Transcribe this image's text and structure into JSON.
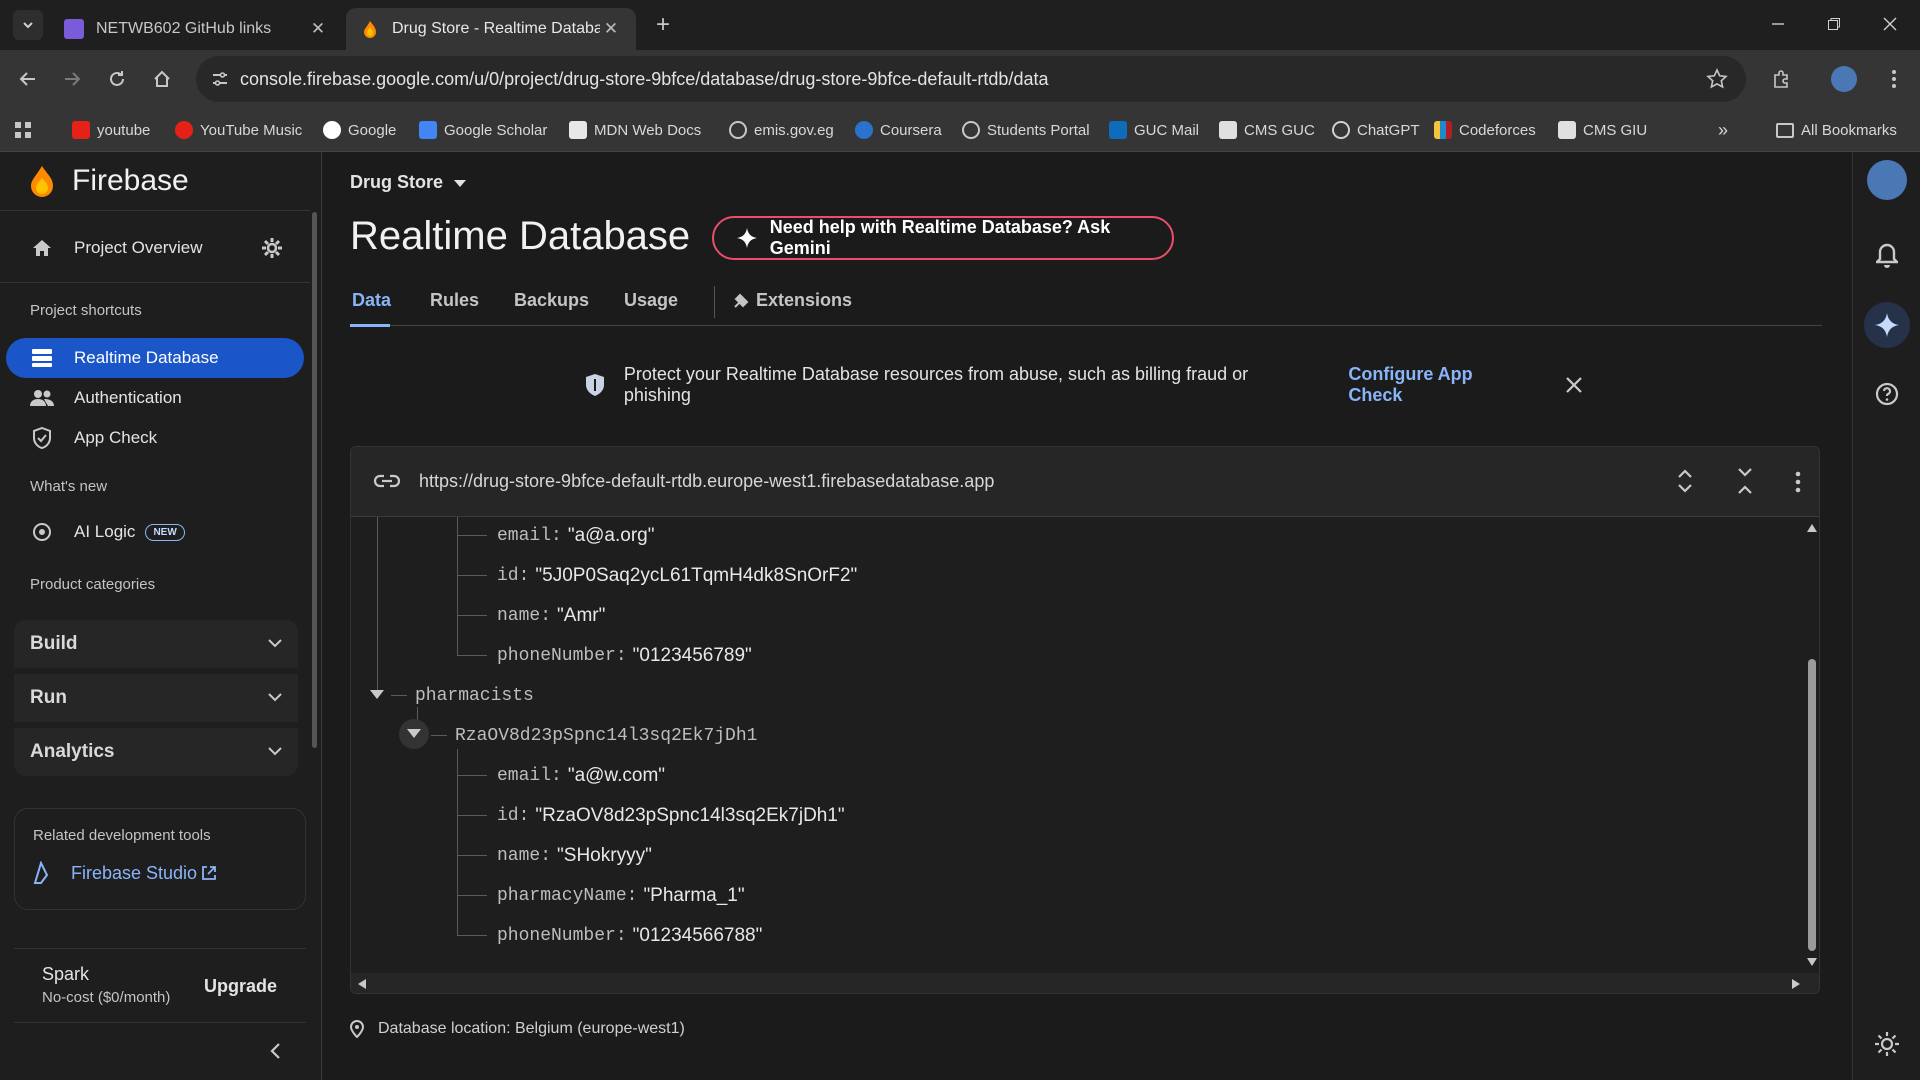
{
  "browser": {
    "tabs": [
      {
        "title": "NETWB602 GitHub links",
        "active": false
      },
      {
        "title": "Drug Store - Realtime Database",
        "active": true
      }
    ],
    "url": "console.firebase.google.com/u/0/project/drug-store-9bfce/database/drug-store-9bfce-default-rtdb/data",
    "bookmarks": [
      "youtube",
      "YouTube Music",
      "Google",
      "Google Scholar",
      "MDN Web Docs",
      "emis.gov.eg",
      "Coursera",
      "Students Portal",
      "GUC Mail",
      "CMS GUC",
      "ChatGPT",
      "Codeforces",
      "CMS GIU"
    ],
    "all_bookmarks_label": "All Bookmarks"
  },
  "sidebar": {
    "brand": "Firebase",
    "project_overview": "Project Overview",
    "shortcuts_title": "Project shortcuts",
    "shortcuts": [
      "Realtime Database",
      "Authentication",
      "App Check"
    ],
    "whats_new_title": "What's new",
    "ai_logic": "AI Logic",
    "new_badge": "NEW",
    "categories_title": "Product categories",
    "categories": [
      "Build",
      "Run",
      "Analytics"
    ],
    "devtools_title": "Related development tools",
    "studio_link": "Firebase Studio",
    "plan_name": "Spark",
    "plan_desc": "No-cost ($0/month)",
    "upgrade": "Upgrade"
  },
  "main": {
    "project_name": "Drug Store",
    "page_title": "Realtime Database",
    "gemini_button": "Need help with Realtime Database? Ask Gemini",
    "tabs": [
      "Data",
      "Rules",
      "Backups",
      "Usage",
      "Extensions"
    ],
    "banner_text": "Protect your Realtime Database resources from abuse, such as billing fraud or phishing",
    "banner_link": "Configure App Check",
    "db_url": "https://drug-store-9bfce-default-rtdb.europe-west1.firebasedatabase.app",
    "location": "Database location: Belgium (europe-west1)"
  },
  "tree": {
    "user_fields": [
      {
        "key": "email",
        "value": "\"a@a.org\""
      },
      {
        "key": "id",
        "value": "\"5J0P0Saq2ycL61TqmH4dk8SnOrF2\""
      },
      {
        "key": "name",
        "value": "\"Amr\""
      },
      {
        "key": "phoneNumber",
        "value": "\"0123456789\""
      }
    ],
    "node_pharmacists": "pharmacists",
    "node_child": "RzaOV8d23pSpnc14l3sq2Ek7jDh1",
    "child_fields": [
      {
        "key": "email",
        "value": "\"a@w.com\""
      },
      {
        "key": "id",
        "value": "\"RzaOV8d23pSpnc14l3sq2Ek7jDh1\""
      },
      {
        "key": "name",
        "value": "\"SHokryyy\""
      },
      {
        "key": "pharmacyName",
        "value": "\"Pharma_1\""
      },
      {
        "key": "phoneNumber",
        "value": "\"01234566788\""
      }
    ]
  },
  "colors": {
    "accent": "#8ab4f8",
    "active_nav": "#1a56c7",
    "gemini_border": "#ea4e6a"
  }
}
